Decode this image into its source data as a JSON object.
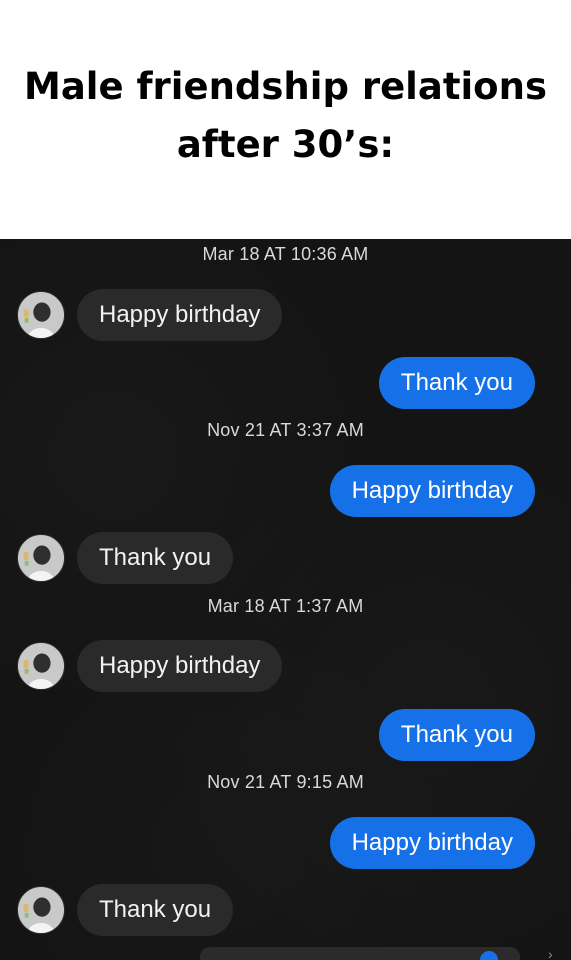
{
  "caption": {
    "line1": "Male friendship relations",
    "line2": "after 30’s:"
  },
  "chat": {
    "timestamps": [
      "Mar 18 AT 10:36 AM",
      "Nov 21 AT 3:37 AM",
      "Mar 18 AT 1:37 AM",
      "Nov 21 AT 9:15 AM"
    ],
    "messages": [
      {
        "text": "Happy birthday",
        "direction": "incoming"
      },
      {
        "text": "Thank you",
        "direction": "outgoing"
      },
      {
        "text": "Happy birthday",
        "direction": "outgoing"
      },
      {
        "text": "Thank you",
        "direction": "incoming"
      },
      {
        "text": "Happy birthday",
        "direction": "incoming"
      },
      {
        "text": "Thank you",
        "direction": "outgoing"
      },
      {
        "text": "Happy birthday",
        "direction": "outgoing"
      },
      {
        "text": "Thank you",
        "direction": "incoming"
      }
    ],
    "colors": {
      "background": "#141414",
      "incoming_bubble": "#2a2a2a",
      "outgoing_bubble": "#1671e8",
      "timestamp_text": "#d9d9d9"
    },
    "avatar_icon": "person-avatar-icon"
  }
}
